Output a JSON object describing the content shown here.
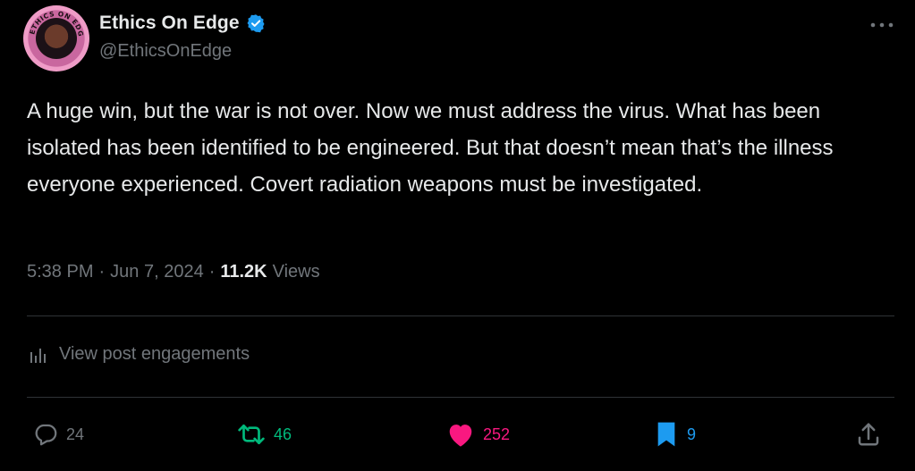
{
  "author": {
    "display_name": "Ethics On Edge",
    "handle": "@EthicsOnEdge",
    "avatar_ring_text": "ETHICS ON EDGE"
  },
  "post": {
    "text": "A huge win, but the war is not over. Now we must address the virus. What has been isolated has been identified to be engineered. But that doesn’t mean that’s the illness everyone experienced. Covert radiation weapons must be investigated.",
    "time": "5:38 PM",
    "date": "Jun 7, 2024",
    "separator": "·",
    "views_count": "11.2K",
    "views_label": "Views"
  },
  "engagements_label": "View post engagements",
  "actions": {
    "replies": "24",
    "reposts": "46",
    "likes": "252",
    "bookmarks": "9"
  },
  "icons": {
    "more": "more-horizontal-icon",
    "verified": "verified-badge-icon",
    "analytics": "analytics-bars-icon",
    "reply": "reply-bubble-icon",
    "repost": "repost-arrows-icon",
    "like": "heart-filled-icon",
    "bookmark": "bookmark-filled-icon",
    "share": "share-upload-icon"
  },
  "colors": {
    "background": "#000000",
    "text_primary": "#e7e9ea",
    "text_secondary": "#71767b",
    "verified_blue": "#1d9bf0",
    "repost_green": "#00ba7c",
    "like_pink": "#f91880",
    "bookmark_blue": "#1d9bf0",
    "divider": "#2f3336"
  }
}
